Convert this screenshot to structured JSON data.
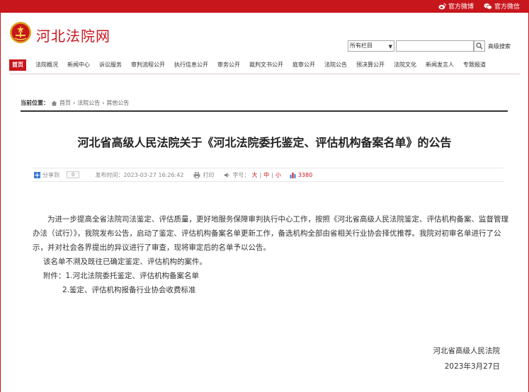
{
  "topbar": {
    "weibo_label": "官方微博",
    "wechat_label": "官方微信",
    "brand_color": "#c8161d"
  },
  "header": {
    "site_name": "河北法院网"
  },
  "search": {
    "scope_value": "所有栏目",
    "placeholder": "",
    "advanced_label": "高级搜索"
  },
  "nav": {
    "items": [
      {
        "label": "首页"
      },
      {
        "label": "法院概况"
      },
      {
        "label": "新闻中心"
      },
      {
        "label": "诉讼服务"
      },
      {
        "label": "审判流程公开"
      },
      {
        "label": "执行信息公开"
      },
      {
        "label": "审务公开"
      },
      {
        "label": "裁判文书公开"
      },
      {
        "label": "庭审公开"
      },
      {
        "label": "法院公告"
      },
      {
        "label": "预决算公开"
      },
      {
        "label": "法院文化"
      },
      {
        "label": "新闻发言人"
      },
      {
        "label": "专题报道"
      }
    ]
  },
  "breadcrumb": {
    "label": "当前位置：",
    "items": [
      "首页",
      "法院公告",
      "其他公告"
    ]
  },
  "article": {
    "title": "河北省高级人民法院关于《河北法院委托鉴定、评估机构备案名单》的公告",
    "share_label": "分享到",
    "share_count": "0",
    "publish_time": "发布时间：2023-03-27 16:26:42",
    "print_label": "打印",
    "font_label": "字号：",
    "font_large": "大",
    "font_medium": "中",
    "font_small": "小",
    "views": "3380",
    "paragraph1": "为进一步提高全省法院司法鉴定、评估质量，更好地服务保障审判执行中心工作，按照《河北省高级人民法院鉴定、评估机构备案、监督管理办法（试行）》，我院发布公告，启动了鉴定、评估机构备案名单更新工作，备选机构全部由省相关行业协会择优推荐。我院对初审名单进行了公示，并对社会各界提出的异议进行了审查，现将审定后的名单予以公告。",
    "paragraph2": "该名单不溯及既往已确定鉴定、评估机构的案件。",
    "attachment1": "附件：1.河北法院委托鉴定、评估机构备案名单",
    "attachment2": "2.鉴定、评估机构报备行业协会收费标准",
    "signature_org": "河北省高级人民法院",
    "signature_date": "2023年3月27日"
  }
}
